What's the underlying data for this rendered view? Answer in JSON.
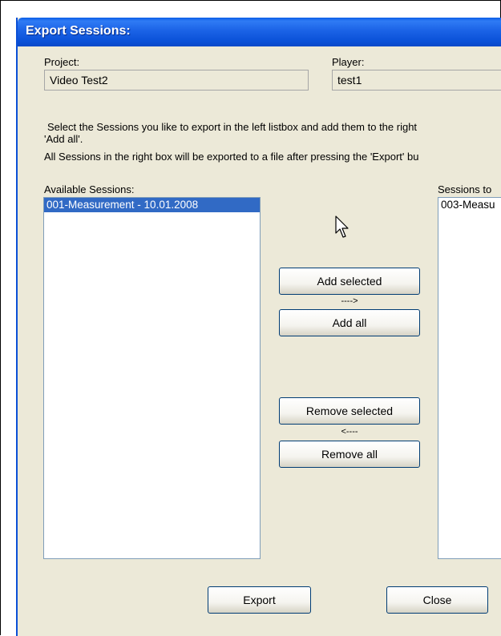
{
  "window": {
    "title": "Export Sessions:"
  },
  "project": {
    "label": "Project:",
    "value": "Video Test2"
  },
  "player": {
    "label": "Player:",
    "value": "test1"
  },
  "instructions": {
    "line1": "Select the Sessions you like to export in the left listbox and add them to the right",
    "line2": "'Add all'.",
    "line3": "All Sessions in the right box will be exported to a file after pressing the 'Export' bu"
  },
  "available": {
    "label": "Available Sessions:",
    "items": [
      "001-Measurement - 10.01.2008"
    ]
  },
  "export_list": {
    "label": "Sessions to",
    "items": [
      "003-Measu"
    ]
  },
  "buttons": {
    "add_selected": "Add selected",
    "add_arrow": "---->",
    "add_all": "Add all",
    "remove_selected": "Remove selected",
    "remove_arrow": "<----",
    "remove_all": "Remove all",
    "export": "Export",
    "close": "Close"
  }
}
